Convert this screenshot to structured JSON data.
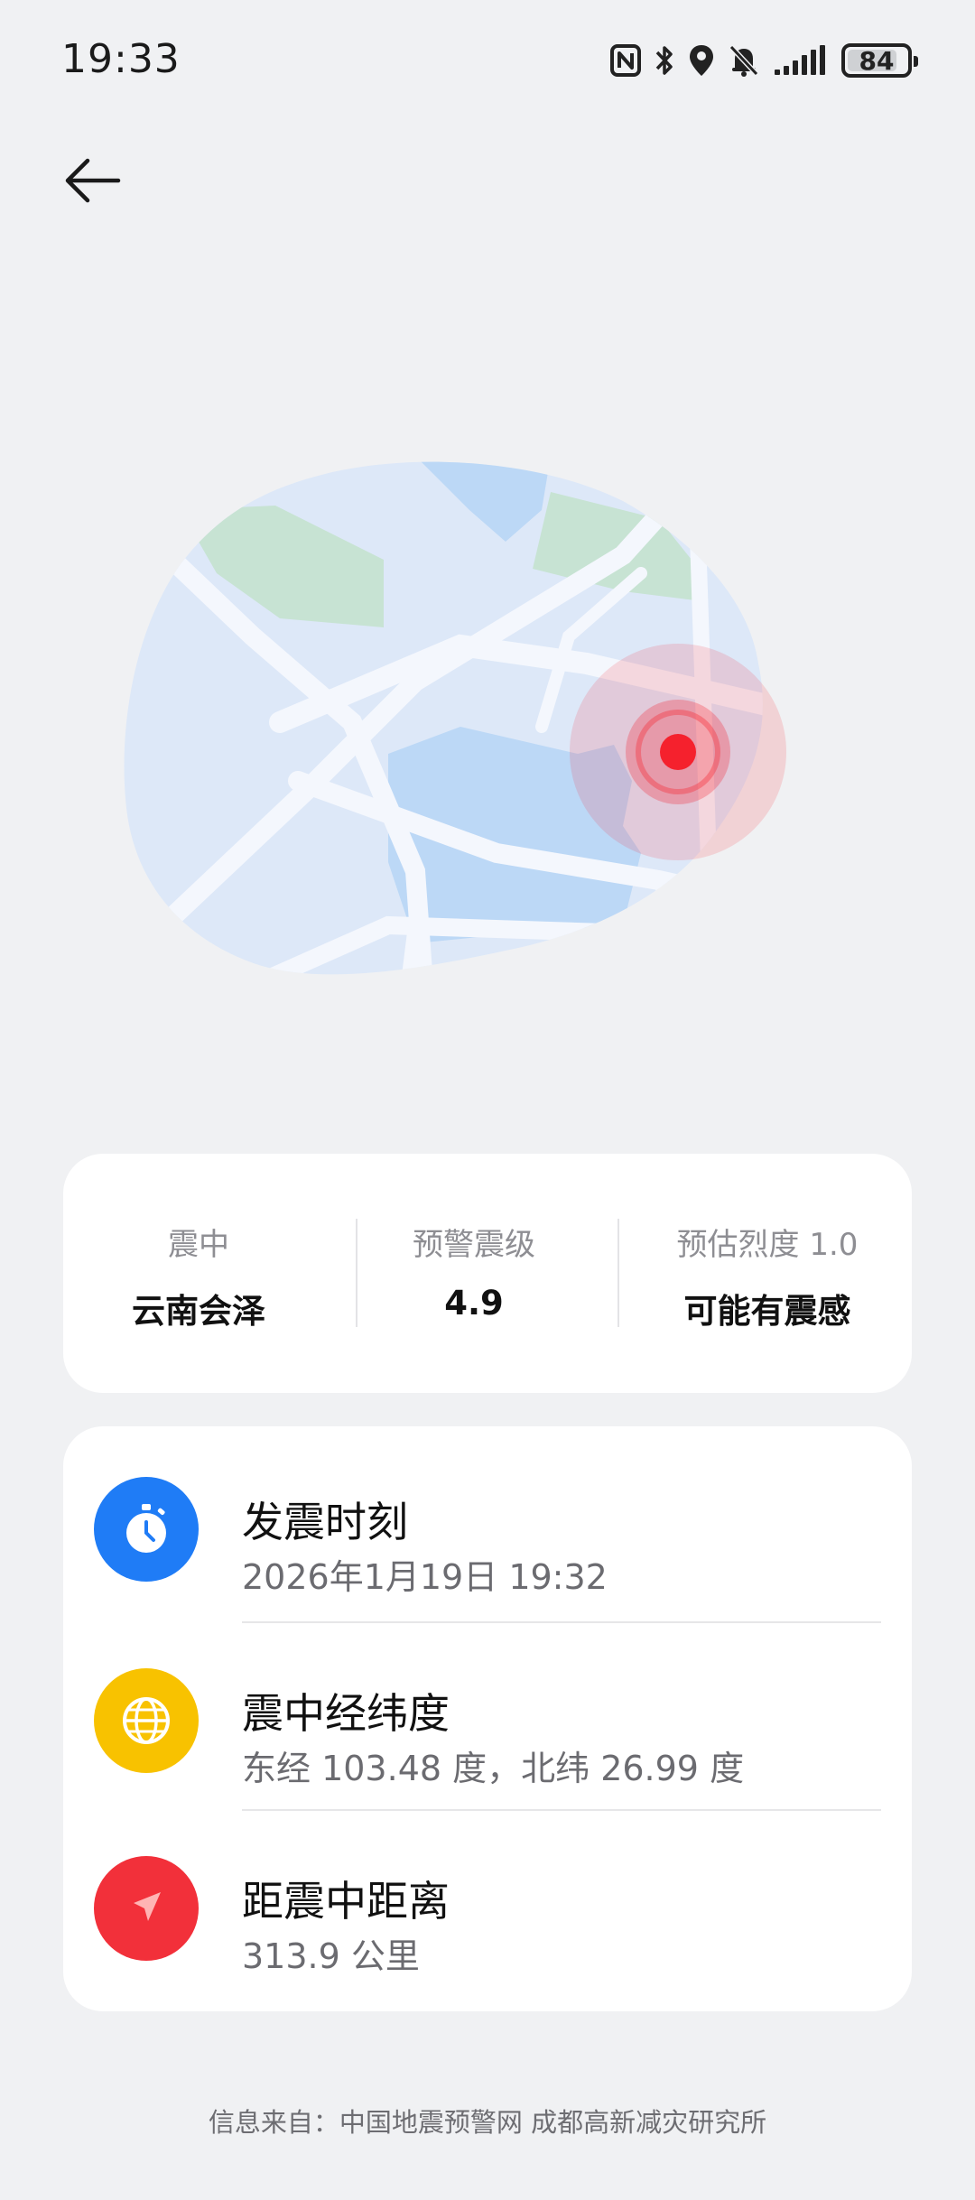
{
  "status_bar": {
    "time": "19:33",
    "battery": "84",
    "battery_level": 0.84,
    "icons": [
      "nfc-icon",
      "bluetooth-icon",
      "location-icon",
      "mute-bell-icon",
      "signal-icon",
      "battery-icon"
    ]
  },
  "header": {
    "back_icon": "arrow-left-icon"
  },
  "summary": {
    "epicenter_label": "震中",
    "epicenter_value": "云南会泽",
    "magnitude_label": "预警震级",
    "magnitude_value": "4.9",
    "intensity_label": "预估烈度 1.0",
    "intensity_value": "可能有震感"
  },
  "details": {
    "time": {
      "title": "发震时刻",
      "value": "2026年1月19日 19:32",
      "icon": "stopwatch-icon",
      "color": "#1f7cf6"
    },
    "coords": {
      "title": "震中经纬度",
      "value": "东经 103.48 度，北纬 26.99 度",
      "icon": "globe-icon",
      "color": "#f8c200"
    },
    "distance": {
      "title": "距震中距离",
      "value": "313.9 公里",
      "icon": "navigation-arrow-icon",
      "color": "#f2303a"
    }
  },
  "footer": {
    "source": "信息来自：中国地震预警网 成都高新减灾研究所"
  },
  "colors": {
    "background": "#f0f1f3",
    "card": "#ffffff",
    "epicenter_marker": "#f5212d"
  }
}
